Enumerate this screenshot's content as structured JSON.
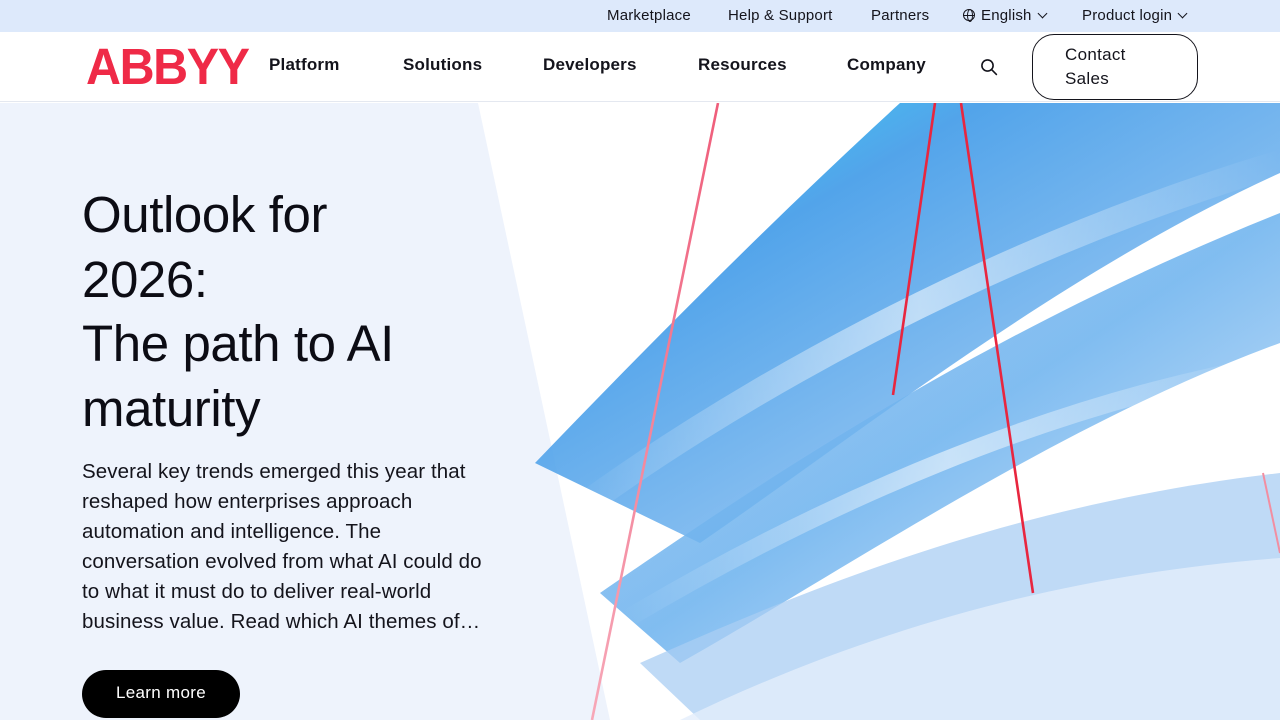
{
  "utility": {
    "marketplace": "Marketplace",
    "help": "Help & Support",
    "partners": "Partners",
    "language": "English",
    "login": "Product login"
  },
  "brand": {
    "logo_text": "ABBYY",
    "logo_color": "#ef2a47"
  },
  "nav": {
    "items": [
      "Platform",
      "Solutions",
      "Developers",
      "Resources",
      "Company"
    ],
    "search_icon": "search-icon",
    "contact_line1": "Contact",
    "contact_line2": "Sales"
  },
  "hero": {
    "title_line1": "Outlook for",
    "title_line2": "2026:",
    "title_line3": "The path to AI",
    "title_line4": "maturity",
    "description": "Several key trends emerged this year that reshaped how enterprises approach automation and intelligence. The conversation evolved from what AI could do to what it must do to deliver real-world business value. Read which AI themes of…",
    "cta_label": "Learn more"
  },
  "colors": {
    "utility_bg": "#dde9fb",
    "hero_bg": "#eef3fc",
    "accent_red": "#ef2a47",
    "wave_blue": "#3f9ae8",
    "wave_cyan": "#22d8f4"
  }
}
